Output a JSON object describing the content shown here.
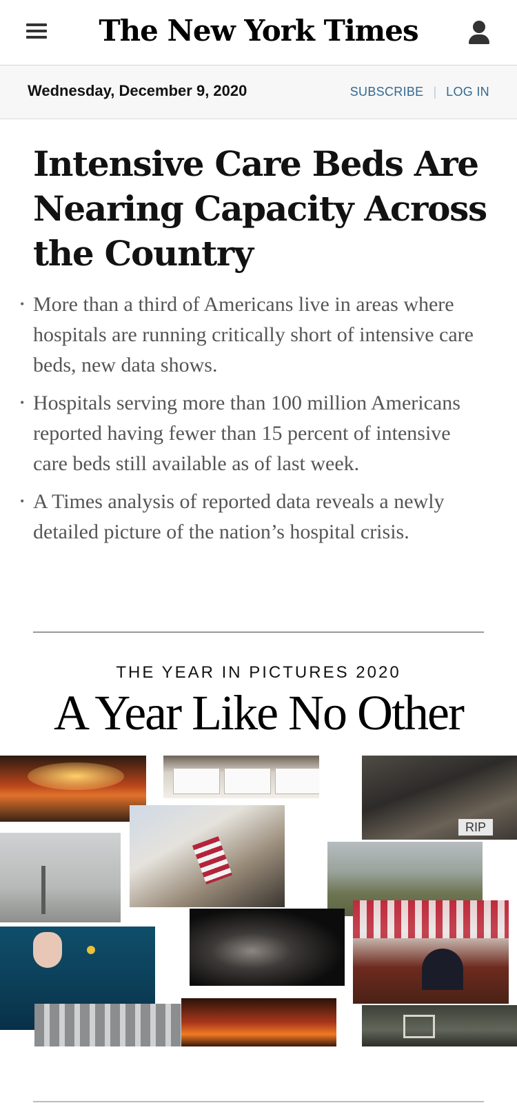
{
  "masthead": {
    "logo_text": "The New York Times",
    "menu_icon": "hamburger-menu-icon",
    "account_icon": "user-account-icon"
  },
  "datebar": {
    "date": "Wednesday, December 9, 2020",
    "subscribe_label": "SUBSCRIBE",
    "separator": "|",
    "login_label": "LOG IN",
    "link_color": "#326891"
  },
  "story": {
    "headline": "Intensive Care Beds Are Nearing Capacity Across the Country",
    "summary": [
      "More than a third of Americans live in areas where hospitals are running critically short of intensive care beds, new data shows.",
      "Hospitals serving more than 100 million Americans reported having fewer than 15 percent of intensive care beds still available as of last week.",
      "A Times analysis of reported data reveals a newly detailed picture of the nation’s hospital crisis."
    ]
  },
  "feature": {
    "kicker": "THE YEAR IN PICTURES 2020",
    "title": "A Year Like No Other",
    "collage_sign_text": "RIP"
  }
}
